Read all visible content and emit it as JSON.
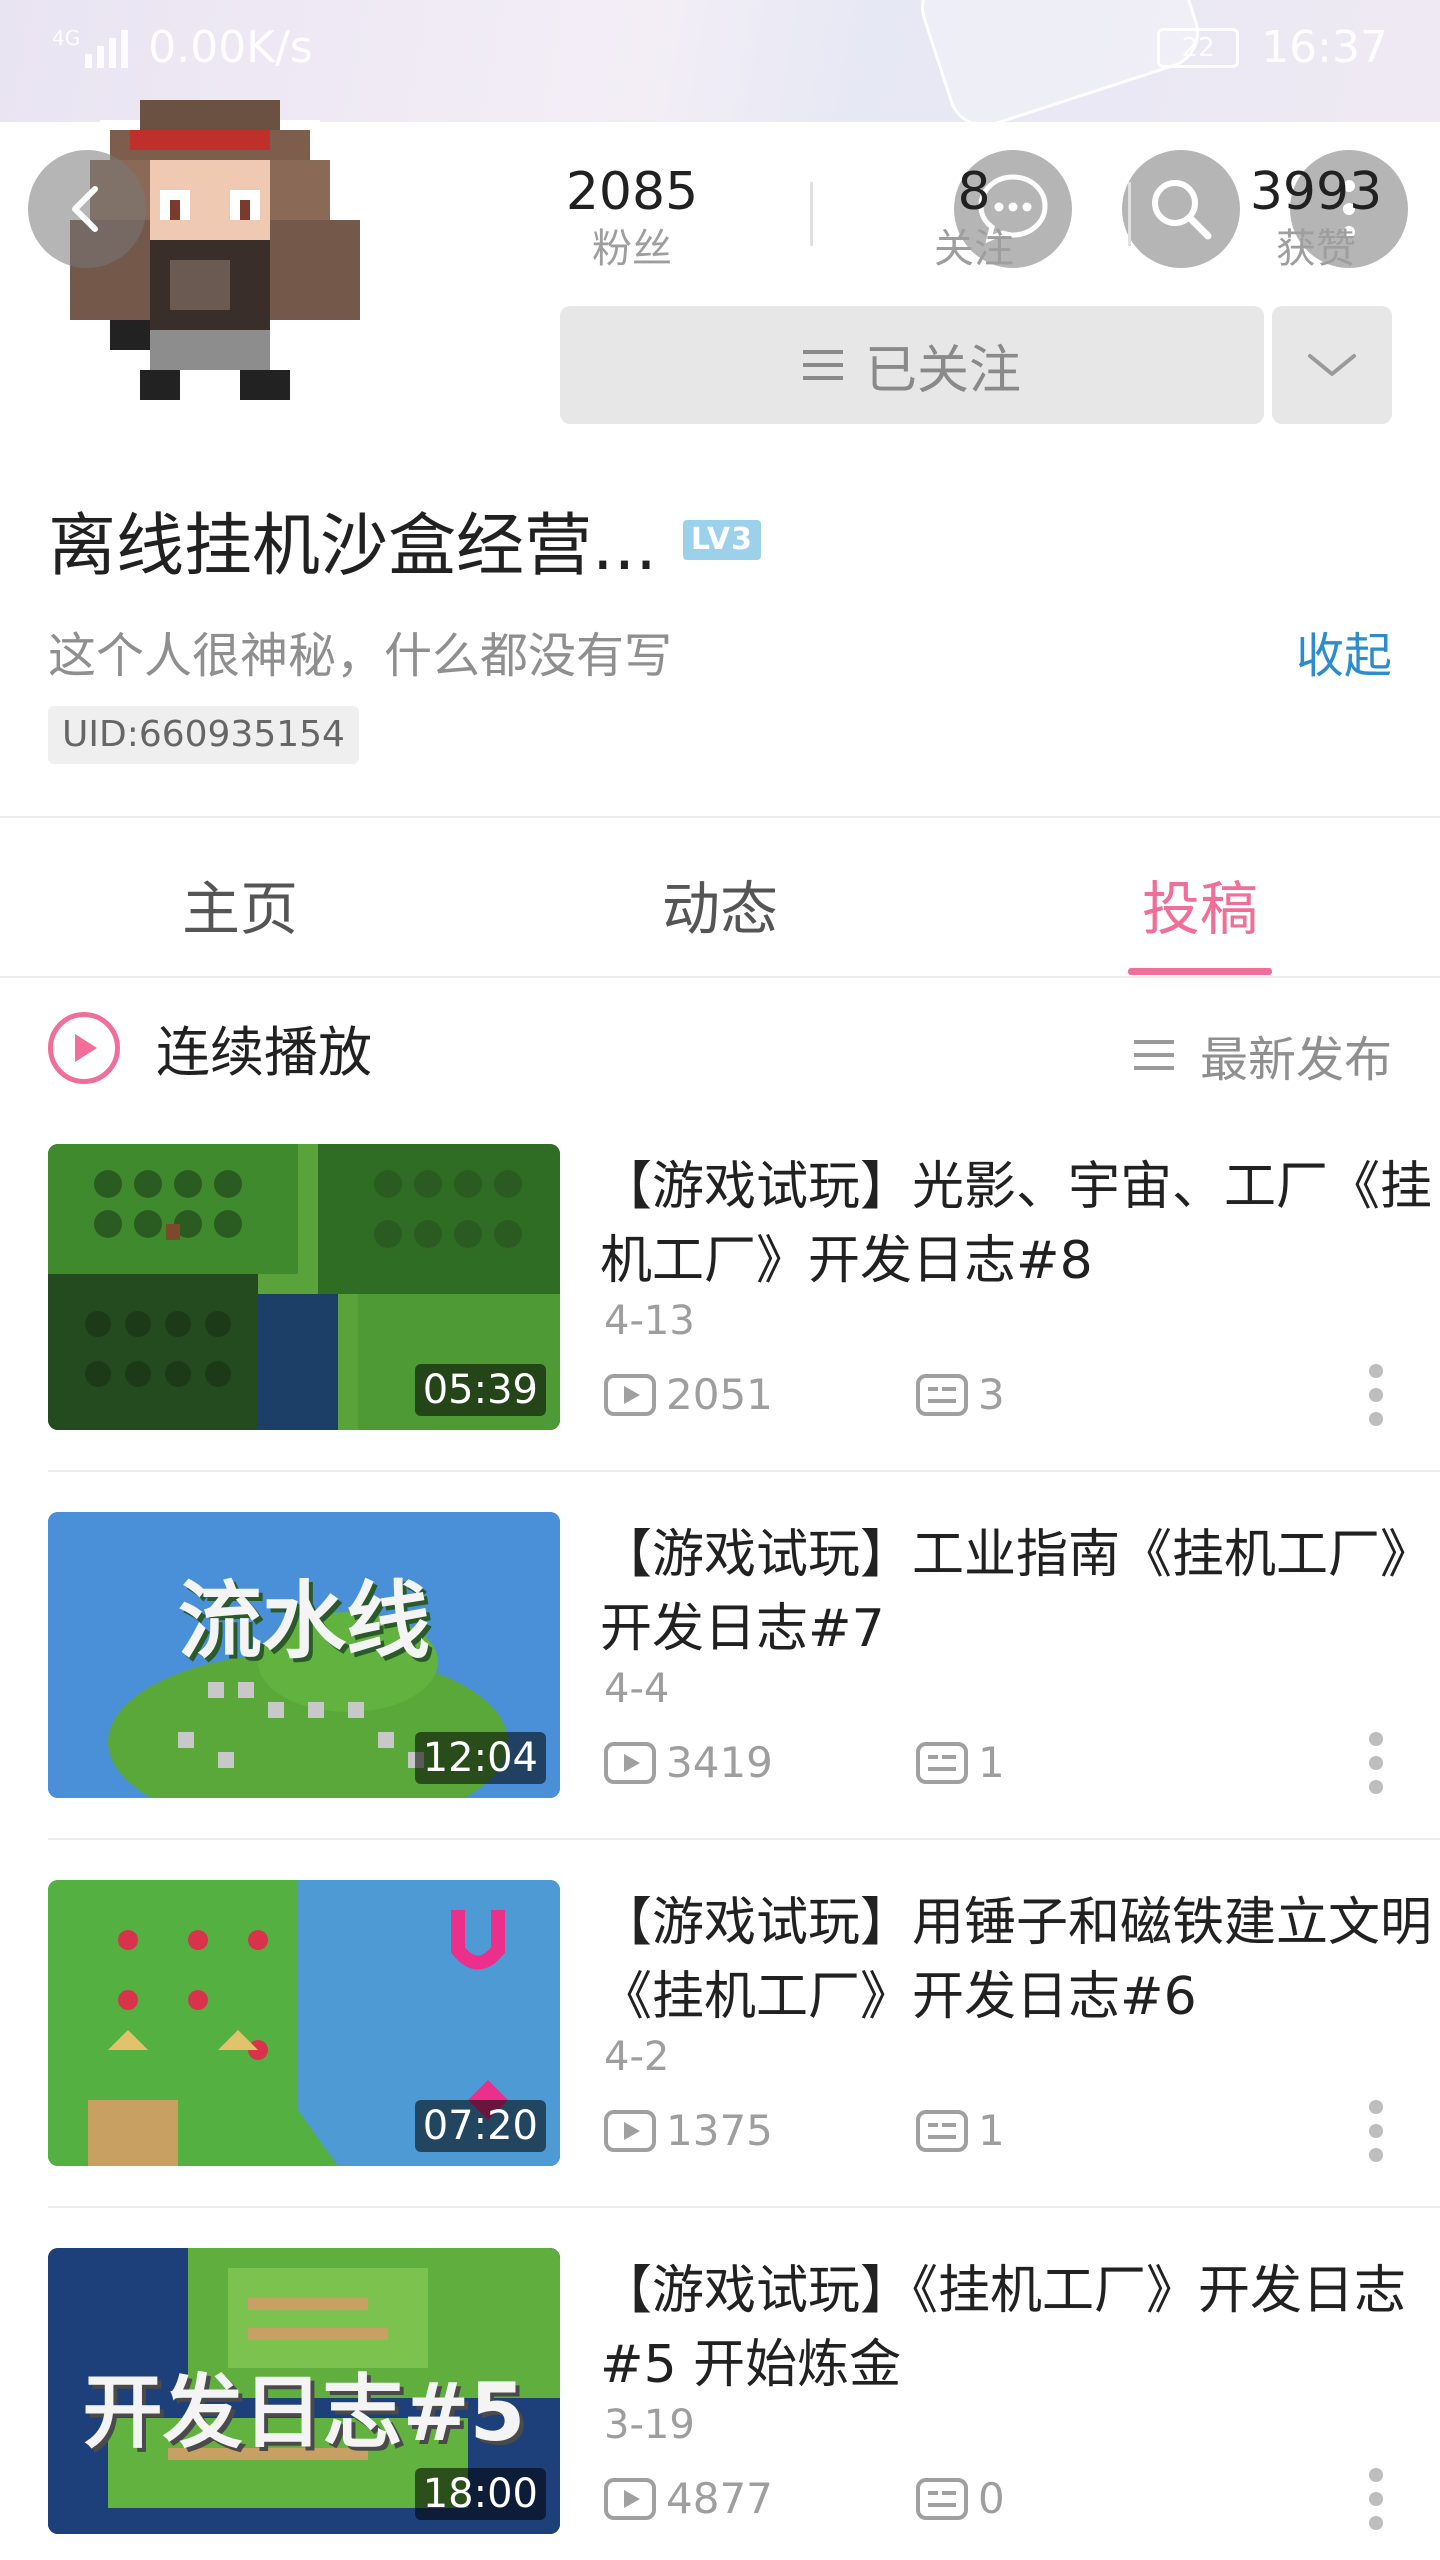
{
  "status_bar": {
    "network": "4G",
    "speed": "0.00K/s",
    "battery": "22",
    "time": "16:37"
  },
  "profile": {
    "stats": [
      {
        "value": "2085",
        "label": "粉丝"
      },
      {
        "value": "8",
        "label": "关注"
      },
      {
        "value": "3993",
        "label": "获赞"
      }
    ],
    "follow_button": "已关注",
    "name": "离线挂机沙盒经营...",
    "level": "LV3",
    "bio": "这个人很神秘，什么都没有写",
    "collapse": "收起",
    "uid": "UID:660935154"
  },
  "tabs": [
    {
      "label": "主页",
      "active": false
    },
    {
      "label": "动态",
      "active": false
    },
    {
      "label": "投稿",
      "active": true
    }
  ],
  "playlist": {
    "play_all": "连续播放",
    "sort": "最新发布"
  },
  "videos": [
    {
      "title": "【游戏试玩】光影、宇宙、工厂《挂机工厂》开发日志#8",
      "date": "4-13",
      "views": "2051",
      "comments": "3",
      "duration": "05:39",
      "thumb_text": ""
    },
    {
      "title": "【游戏试玩】工业指南《挂机工厂》开发日志#7",
      "date": "4-4",
      "views": "3419",
      "comments": "1",
      "duration": "12:04",
      "thumb_text": "流水线"
    },
    {
      "title": "【游戏试玩】用锤子和磁铁建立文明 《挂机工厂》开发日志#6",
      "date": "4-2",
      "views": "1375",
      "comments": "1",
      "duration": "07:20",
      "thumb_text": ""
    },
    {
      "title": "【游戏试玩】《挂机工厂》开发日志#5 开始炼金",
      "date": "3-19",
      "views": "4877",
      "comments": "0",
      "duration": "18:00",
      "thumb_text": "开发日志#5"
    }
  ],
  "colors": {
    "accent": "#f06e97",
    "link": "#2d8ccf",
    "level_badge": "#9bd1ea"
  }
}
